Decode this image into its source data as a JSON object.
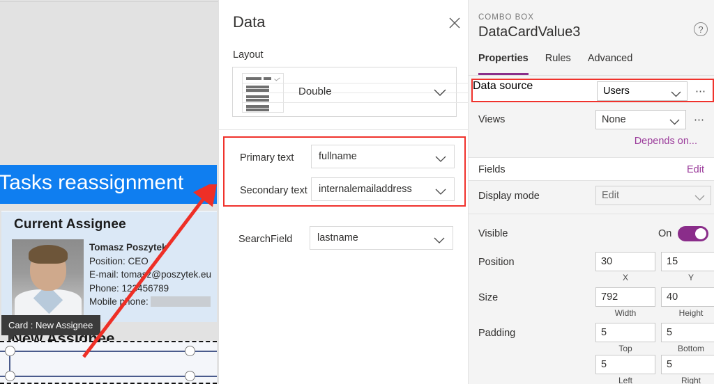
{
  "canvas": {
    "app_banner_title": "ow Tasks reassignment",
    "banner_color": "#0f7ef0",
    "card": {
      "heading": "Current Assignee",
      "name": "Tomasz Poszytek",
      "position": "Position: CEO",
      "email": "E-mail: tomasz@poszytek.eu",
      "phone": "Phone: 123456789",
      "mobile_phone_label": "Mobile phone:"
    },
    "new_assignee_title": "New Assignee",
    "tooltip": "Card : New Assignee"
  },
  "data_panel": {
    "title": "Data",
    "close_icon": "close-icon",
    "layout": {
      "label": "Layout",
      "value": "Double",
      "chevron_icon": "chevron-down-icon"
    },
    "fields": [
      {
        "label": "Primary text",
        "value": "fullname"
      },
      {
        "label": "Secondary text",
        "value": "internalemailaddress"
      },
      {
        "label": "SearchField",
        "value": "lastname"
      }
    ],
    "highlight_color": "#f0322c"
  },
  "properties_panel": {
    "kind": "COMBO BOX",
    "title": "DataCardValue3",
    "help_icon": "help-circle-icon",
    "tabs": [
      {
        "label": "Properties",
        "active": true
      },
      {
        "label": "Rules",
        "active": false
      },
      {
        "label": "Advanced",
        "active": false
      }
    ],
    "accent_color": "#8a2d8a",
    "data_source": {
      "label": "Data source",
      "value": "Users",
      "ellipsis": "⋯"
    },
    "views": {
      "label": "Views",
      "value": "None",
      "ellipsis": "⋯"
    },
    "depends_on": "Depends on...",
    "fields": {
      "label": "Fields",
      "edit_label": "Edit"
    },
    "display_mode": {
      "label": "Display mode",
      "value": "Edit"
    },
    "visible": {
      "label": "Visible",
      "state": "On"
    },
    "position": {
      "label": "Position",
      "x": "30",
      "y": "15",
      "x_caption": "X",
      "y_caption": "Y"
    },
    "size": {
      "label": "Size",
      "width": "792",
      "height": "40",
      "width_caption": "Width",
      "height_caption": "Height"
    },
    "padding": {
      "label": "Padding",
      "top": "5",
      "bottom": "5",
      "left": "5",
      "right": "5",
      "top_caption": "Top",
      "bottom_caption": "Bottom",
      "left_caption": "Left",
      "right_caption": "Right"
    }
  }
}
